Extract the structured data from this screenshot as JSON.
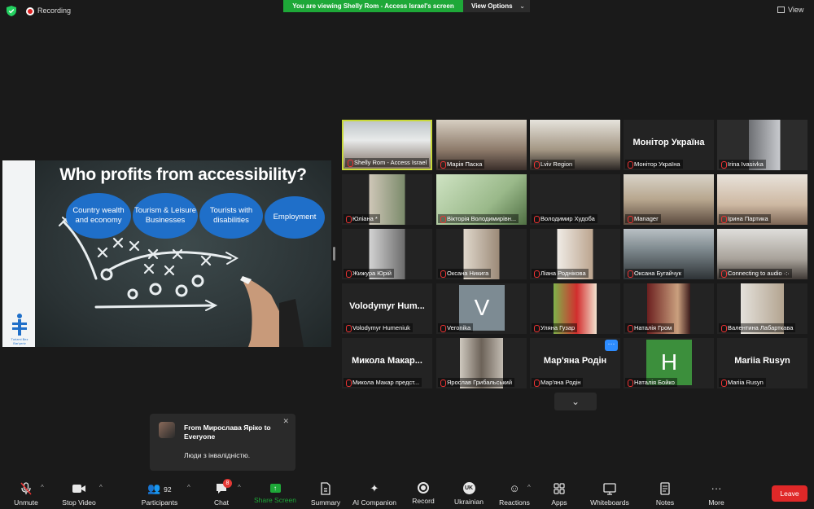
{
  "topbar": {
    "recording_label": "Recording",
    "viewing_banner": "You are viewing Shelly Rom - Access Israel's screen",
    "view_options_label": "View Options",
    "view_label": "View"
  },
  "slide": {
    "title": "Who profits from accessibility?",
    "bubbles": [
      "Country wealth and economy",
      "Tourism & Leisure Businesses",
      "Tourists with disabilities",
      "Employment"
    ],
    "logo_text": "Turizmi Bez Bar'yeriv",
    "colors": {
      "bubble": "#1f6fc9",
      "board": "#2b3436"
    }
  },
  "gallery": {
    "tiles": [
      {
        "name": "Shelly Rom - Access Israel",
        "big": "",
        "kind": "video"
      },
      {
        "name": "Марія Паска",
        "big": "",
        "kind": "video"
      },
      {
        "name": "Lviv Region",
        "big": "",
        "kind": "video"
      },
      {
        "name": "Монітор Україна",
        "big": "Монітор Україна",
        "kind": "name"
      },
      {
        "name": "Irina Ivasivka",
        "big": "",
        "kind": "video"
      },
      {
        "name": "Юліана *",
        "big": "",
        "kind": "video"
      },
      {
        "name": "Вікторія Володимирівн...",
        "big": "",
        "kind": "video"
      },
      {
        "name": "Володимир Худоба",
        "big": "",
        "kind": "dark"
      },
      {
        "name": "Manager",
        "big": "",
        "kind": "video"
      },
      {
        "name": "Ірина Партика",
        "big": "",
        "kind": "video"
      },
      {
        "name": "Жижура Юрій",
        "big": "",
        "kind": "video"
      },
      {
        "name": "Оксана Никига",
        "big": "",
        "kind": "video"
      },
      {
        "name": "Ліана Роднікова",
        "big": "",
        "kind": "video"
      },
      {
        "name": "Оксана Бугайчук",
        "big": "",
        "kind": "video"
      },
      {
        "name": "Connecting to audio ·:·",
        "big": "",
        "kind": "video"
      },
      {
        "name": "Volodymyr Humeniuk",
        "big": "Volodymyr  Hum...",
        "kind": "name"
      },
      {
        "name": "Veronika",
        "big": "V",
        "kind": "avatar"
      },
      {
        "name": "Уляна Гузар",
        "big": "",
        "kind": "photo"
      },
      {
        "name": "Наталія Гром",
        "big": "",
        "kind": "photo"
      },
      {
        "name": "Валентина Лабарткава",
        "big": "",
        "kind": "video"
      },
      {
        "name": "Микола Макар предст...",
        "big": "Микола  Макар...",
        "kind": "name"
      },
      {
        "name": "Ярослав Грибальський",
        "big": "",
        "kind": "photo"
      },
      {
        "name": "Мар'яна Родін",
        "big": "Мар'яна Родін",
        "kind": "name"
      },
      {
        "name": "Наталія Бойко",
        "big": "H",
        "kind": "avatar"
      },
      {
        "name": "Mariia Rusyn",
        "big": "Mariia Rusyn",
        "kind": "name"
      }
    ],
    "more_dots": "···",
    "scroll_down": "⌄"
  },
  "chat_toast": {
    "from": "From Мирослава Яріко to Everyone",
    "message": "Люди з інвалідністю.",
    "close": "✕"
  },
  "toolbar": {
    "unmute": "Unmute",
    "stop_video": "Stop Video",
    "participants": "Participants",
    "participants_count": "92",
    "chat": "Chat",
    "chat_badge": "8",
    "share_screen": "Share Screen",
    "summary": "Summary",
    "ai_companion": "AI Companion",
    "record": "Record",
    "language": "Ukrainian",
    "language_code": "UK",
    "reactions": "Reactions",
    "apps": "Apps",
    "whiteboards": "Whiteboards",
    "notes": "Notes",
    "more": "More",
    "leave": "Leave"
  }
}
